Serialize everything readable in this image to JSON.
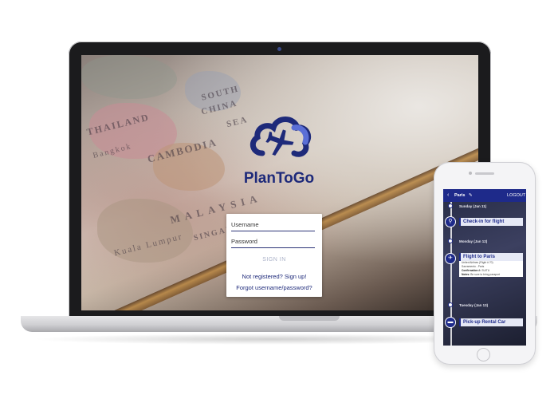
{
  "app": {
    "brand": "PlanToGo"
  },
  "login": {
    "username_placeholder": "Username",
    "password_placeholder": "Password",
    "sign_in_label": "SIGN IN",
    "signup_link": "Not registered? Sign up!",
    "forgot_link": "Forgot username/password?"
  },
  "map_labels": [
    "THAILAND",
    "CAMBODIA",
    "SOUTH",
    "CHINA",
    "SEA",
    "MALAYSIA",
    "Bangkok",
    "SINGAPORE",
    "Kuala Lumpur"
  ],
  "mobile": {
    "back_icon": "chevron-left-icon",
    "trip_title": "Paris",
    "edit_icon": "pencil-icon",
    "logout_label": "LOGOUT",
    "days": [
      {
        "label": "Sunday (Jan 11)"
      },
      {
        "label": "Monday (Jan 12)"
      },
      {
        "label": "Tuesday (Jan 13)"
      }
    ],
    "events": [
      {
        "icon": "map-pin-icon",
        "title": "Check-in for flight"
      },
      {
        "icon": "airplane-icon",
        "title": "Flight to Paris",
        "details": [
          "United Airlines (Flight # 70)",
          "Sacramento - Paris"
        ],
        "confirmation_label": "Confirmation #:",
        "confirmation_value": "SUITU",
        "notes_label": "Notes:",
        "notes_value": "Be sure to bring passport"
      },
      {
        "icon": "car-icon",
        "title": "Pick-up Rental Car"
      }
    ]
  },
  "colors": {
    "brand_navy": "#1e2a8a",
    "logo_blue": "#5b6fd6",
    "link": "#1e2a7a",
    "signin_disabled": "#aab1c8"
  }
}
